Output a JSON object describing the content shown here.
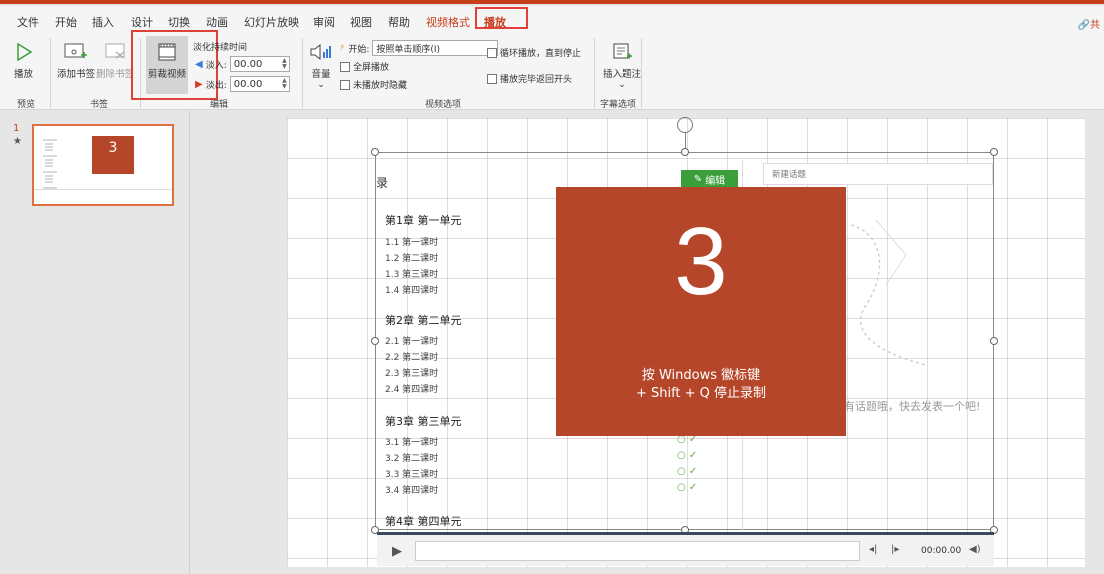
{
  "ribbon_tabs": [
    "文件",
    "开始",
    "插入",
    "设计",
    "切换",
    "动画",
    "幻灯片放映",
    "审阅",
    "视图",
    "帮助",
    "视频格式",
    "播放"
  ],
  "share_label": "🔗共",
  "buttons": {
    "play": "播放",
    "add_bookmark": "添加书签",
    "remove_bookmark": "删除书签",
    "trim_video": "剪裁视频",
    "volume": "音量",
    "insert_caption": "插入题注",
    "caption_arrow": "⌄",
    "volume_arrow": "⌄"
  },
  "fade": {
    "title": "淡化持续时间",
    "in_label": "淡入:",
    "in_value": "00.00",
    "out_label": "淡出:",
    "out_value": "00.00"
  },
  "video_options": {
    "start_label": "开始:",
    "start_value": "按照单击顺序(I)",
    "fullscreen": "全屏播放",
    "hide_not_playing": "未播放时隐藏",
    "loop": "循环播放，直到停止",
    "rewind": "播放完毕返回开头"
  },
  "group_labels": {
    "preview": "预览",
    "bookmarks": "书签",
    "editing": "编辑",
    "video_options": "视频选项",
    "caption_options": "字幕选项"
  },
  "slide_panel": {
    "number": "1",
    "marker": "★"
  },
  "slide": {
    "toc_header_fragment": "录",
    "chapters": [
      {
        "title": "第1章 第一单元",
        "lessons": [
          "1.1 第一课时",
          "1.2 第二课时",
          "1.3 第三课时",
          "1.4 第四课时"
        ]
      },
      {
        "title": "第2章 第二单元",
        "lessons": [
          "2.1 第一课时",
          "2.2 第二课时",
          "2.3 第三课时",
          "2.4 第四课时"
        ]
      },
      {
        "title": "第3章 第三单元",
        "lessons": [
          "3.1 第一课时",
          "3.2 第二课时",
          "3.3 第三课时",
          "3.4 第四课时"
        ]
      },
      {
        "title": "第4章 第四单元",
        "lessons": []
      }
    ],
    "edit_button": "编辑",
    "new_topic_placeholder": "新建话题",
    "no_topic_text": "有话题哦，快去发表一个吧!"
  },
  "countdown": {
    "number": "3",
    "line1": "按 Windows 徽标键",
    "line2": "+ Shift + Q 停止录制"
  },
  "player": {
    "time": "00:00.00"
  },
  "colors": {
    "accent": "#c43e1c",
    "highlight": "#e0403a",
    "countdown_bg": "#b6462a"
  }
}
